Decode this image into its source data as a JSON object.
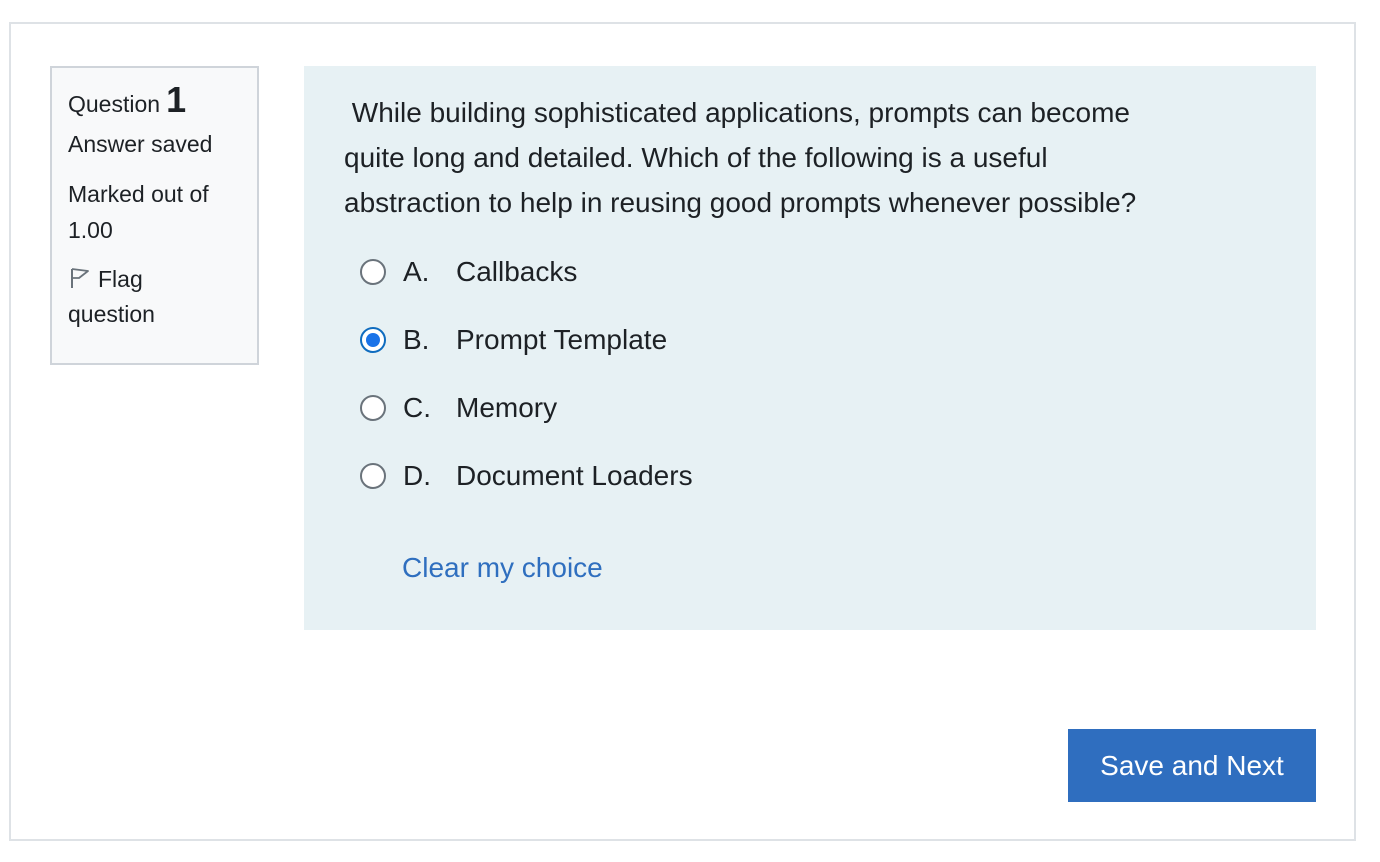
{
  "question_info": {
    "label": "Question",
    "number": "1",
    "state": "Answer saved",
    "grade_line1": "Marked out of",
    "grade_line2": "1.00",
    "flag_line1": "Flag",
    "flag_line2": "question",
    "flag_icon": "flag-outline-icon"
  },
  "question": {
    "text": " While building sophisticated applications, prompts can become\nquite long and detailed. Which of the following is a useful\nabstraction to help in reusing good prompts whenever possible?",
    "options": [
      {
        "letter": "A.",
        "text": "Callbacks",
        "selected": false
      },
      {
        "letter": "B.",
        "text": "Prompt Template",
        "selected": true
      },
      {
        "letter": "C.",
        "text": "Memory",
        "selected": false
      },
      {
        "letter": "D.",
        "text": "Document Loaders",
        "selected": false
      }
    ],
    "clear_label": "Clear my choice"
  },
  "actions": {
    "save_next_label": "Save and Next"
  },
  "colors": {
    "content_bg": "#e7f1f4",
    "info_bg": "#f8f9fa",
    "accent": "#2f6ebf",
    "link": "#2f6fbf",
    "radio_selected": "#1a73e8"
  }
}
